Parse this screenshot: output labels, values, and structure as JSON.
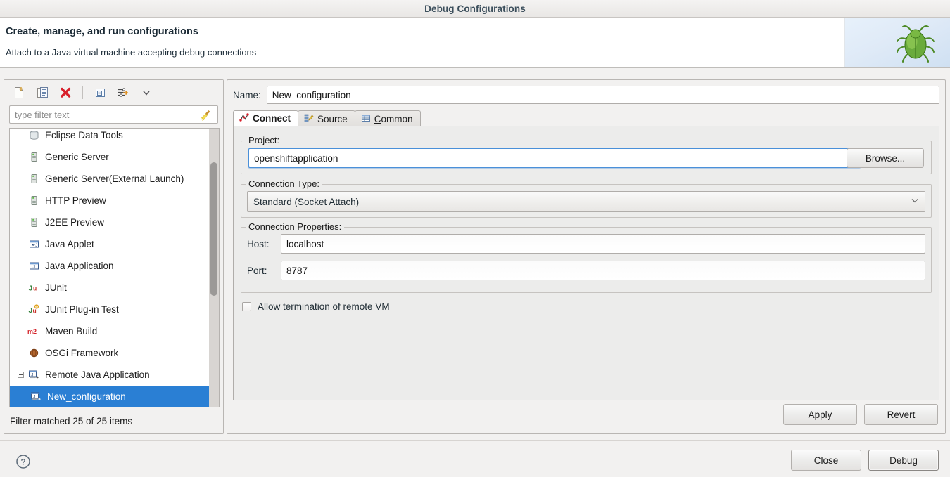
{
  "window": {
    "title": "Debug Configurations"
  },
  "header": {
    "title": "Create, manage, and run configurations",
    "subtitle": "Attach to a Java virtual machine accepting debug connections",
    "banner_icon": "green-bug-icon"
  },
  "toolbar": {
    "buttons": [
      {
        "name": "new-launch-configuration",
        "icon": "new-document-icon"
      },
      {
        "name": "duplicate-launch-configuration",
        "icon": "copy-document-icon"
      },
      {
        "name": "delete-launch-configuration",
        "icon": "red-x-delete-icon"
      },
      {
        "name": "collapse-all",
        "icon": "collapse-all-icon"
      },
      {
        "name": "filter-launch-configurations",
        "icon": "filter-arrow-icon"
      },
      {
        "name": "view-menu",
        "icon": "chevron-down-icon"
      }
    ]
  },
  "filter": {
    "placeholder": "type filter text",
    "value": "",
    "clear_icon": "broom-clear-icon"
  },
  "tree": {
    "items": [
      {
        "label": "Eclipse Data Tools",
        "icon": "data-tools-icon",
        "indent": 0,
        "selected": false,
        "clipped": true
      },
      {
        "label": "Generic Server",
        "icon": "server-icon",
        "indent": 0,
        "selected": false
      },
      {
        "label": "Generic Server(External Launch)",
        "icon": "server-icon",
        "indent": 0,
        "selected": false
      },
      {
        "label": "HTTP Preview",
        "icon": "server-icon",
        "indent": 0,
        "selected": false
      },
      {
        "label": "J2EE Preview",
        "icon": "server-icon",
        "indent": 0,
        "selected": false
      },
      {
        "label": "Java Applet",
        "icon": "java-applet-icon",
        "indent": 0,
        "selected": false
      },
      {
        "label": "Java Application",
        "icon": "java-application-icon",
        "indent": 0,
        "selected": false
      },
      {
        "label": "JUnit",
        "icon": "junit-icon",
        "indent": 0,
        "selected": false
      },
      {
        "label": "JUnit Plug-in Test",
        "icon": "junit-plugin-icon",
        "indent": 0,
        "selected": false
      },
      {
        "label": "Maven Build",
        "icon": "maven-m2-icon",
        "indent": 0,
        "selected": false
      },
      {
        "label": "OSGi Framework",
        "icon": "osgi-icon",
        "indent": 0,
        "selected": false
      },
      {
        "label": "Remote Java Application",
        "icon": "remote-java-application-icon",
        "indent": 0,
        "selected": false,
        "expanded": true
      },
      {
        "label": "New_configuration",
        "icon": "remote-java-application-icon",
        "indent": 1,
        "selected": true
      }
    ],
    "status": "Filter matched 25 of 25 items"
  },
  "form": {
    "name_label": "Name:",
    "name_value": "New_configuration",
    "tabs": [
      {
        "label": "Connect",
        "icon": "connect-icon",
        "active": true
      },
      {
        "label": "Source",
        "icon": "source-icon",
        "active": false
      },
      {
        "label": "Common",
        "icon": "common-icon",
        "active": false,
        "mnemonic": "C"
      }
    ],
    "project": {
      "group_label": "Project:",
      "value": "openshiftapplication",
      "browse_label": "Browse..."
    },
    "connection_type": {
      "group_label": "Connection Type:",
      "selected": "Standard (Socket Attach)",
      "arrow_icon": "chevron-down-icon"
    },
    "connection_properties": {
      "group_label": "Connection Properties:",
      "host_label": "Host:",
      "host_value": "localhost",
      "port_label": "Port:",
      "port_value": "8787"
    },
    "allow_termination": {
      "label": "Allow termination of remote VM",
      "checked": false
    },
    "apply_label": "Apply",
    "revert_label": "Revert"
  },
  "footer": {
    "help_icon": "question-mark-help-icon",
    "close_label": "Close",
    "debug_label": "Debug"
  },
  "colors": {
    "selection_blue": "#2a7fd4",
    "focus_blue": "#4a90d9",
    "title_text": "#3c4f5c",
    "panel_bg": "#f2f1f0",
    "pane_bg": "#ececeb"
  }
}
